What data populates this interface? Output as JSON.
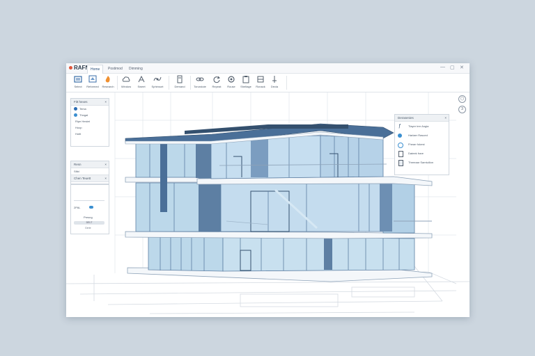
{
  "window": {
    "app_name": "RAFN",
    "tabs": [
      "Home",
      "Postimod",
      "Dimming"
    ],
    "controls": [
      "—",
      "▢",
      "✕"
    ]
  },
  "ribbon": {
    "buttons": [
      {
        "label": "Select",
        "icon": "select-icon"
      },
      {
        "label": "Reformed",
        "icon": "transform-icon"
      },
      {
        "label": "Research",
        "icon": "fire-icon"
      },
      {
        "label": "Window",
        "icon": "cloud-icon"
      },
      {
        "label": "Sweet",
        "icon": "sweep-icon"
      },
      {
        "label": "Sphinsort",
        "icon": "mesh-icon"
      },
      {
        "label": "Demand",
        "icon": "document-icon"
      },
      {
        "label": "Torundute",
        "icon": "link-icon"
      },
      {
        "label": "Repeat",
        "icon": "rotate-icon"
      },
      {
        "label": "Rouse",
        "icon": "gear-icon"
      },
      {
        "label": "Sheltage",
        "icon": "clipboard-icon"
      },
      {
        "label": "Ronack",
        "icon": "layers-icon"
      },
      {
        "label": "Decia",
        "icon": "pin-icon"
      }
    ]
  },
  "left_panel_top": {
    "title": "Fitt hexes",
    "rows": [
      "Tema",
      "Thngal",
      "Ripe  Hestet",
      "Hoop",
      "Hotit"
    ]
  },
  "left_panel_mid": {
    "title": "Resn",
    "field_value": "Sfibl",
    "section": "Chen Teuett"
  },
  "left_panel_bottom": {
    "value_label": "2PAL",
    "label": "Presng",
    "button": "DELT",
    "sub": "Gerie"
  },
  "right_panel": {
    "title": "Derasenies",
    "items": [
      {
        "icon": "pen-icon",
        "label": "Tlayer trer Angia"
      },
      {
        "icon": "globe-icon",
        "label": "Harlaer Rasced"
      },
      {
        "icon": "circle-icon",
        "label": "Fhearr fokest"
      },
      {
        "icon": "document-icon",
        "label": "Dateek frare"
      },
      {
        "icon": "clipboard-icon",
        "label": "Threeaar Samtuilion"
      }
    ]
  },
  "nav": [
    "◯",
    "3"
  ],
  "colors": {
    "glass": "#bcd8ea",
    "frame": "#5d7fa3",
    "roof": "#4a6f98",
    "slab": "#f4f7fa"
  }
}
